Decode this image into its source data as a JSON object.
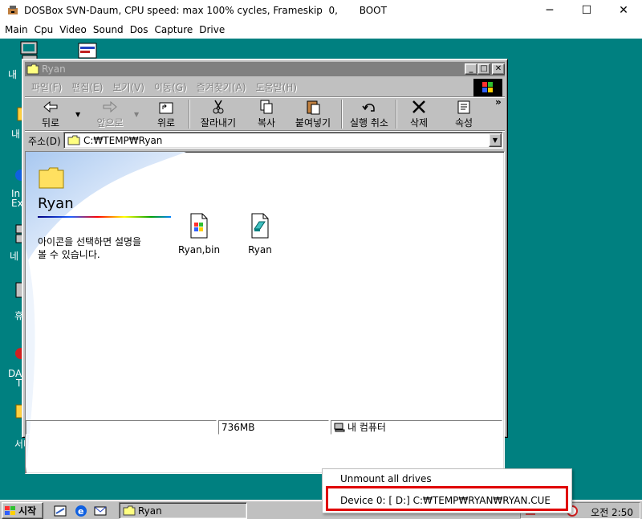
{
  "host": {
    "title": "DOSBox SVN-Daum, CPU speed: max 100% cycles, Frameskip  0,       BOOT",
    "minimize": "─",
    "maximize": "☐",
    "close": "✕",
    "menu": [
      "Main",
      "Cpu",
      "Video",
      "Sound",
      "Dos",
      "Capture",
      "Drive"
    ]
  },
  "desktop": {
    "labels": [
      "내",
      "내",
      "In",
      "Ex",
      "네",
      "휴",
      "DA",
      "T",
      "서비스"
    ]
  },
  "window": {
    "title": "Ryan",
    "menu": [
      "파일(F)",
      "편집(E)",
      "보기(V)",
      "이동(G)",
      "즐겨찾기(A)",
      "도움말(H)"
    ],
    "toolbar": {
      "back": "뒤로",
      "forward": "앞으로",
      "up": "위로",
      "cut": "잘라내기",
      "copy": "복사",
      "paste": "붙여넣기",
      "undo": "실행 취소",
      "delete": "삭제",
      "properties": "속성",
      "more": "»"
    },
    "address": {
      "label": "주소(D)",
      "value": "C:₩TEMP₩Ryan"
    },
    "pane": {
      "title": "Ryan",
      "description_line1": "아이콘을 선택하면 설명을",
      "description_line2": "볼 수 있습니다."
    },
    "files": [
      {
        "name": "Ryan,bin",
        "icon": "windows-file-icon"
      },
      {
        "name": "Ryan",
        "icon": "cd-image-file-icon"
      }
    ],
    "status": {
      "size": "736MB",
      "location": "내 컴퓨터"
    }
  },
  "taskbar": {
    "start": "시작",
    "task": "Ryan",
    "clock": "오전 2:50"
  },
  "popup": {
    "items": [
      "Unmount all drives",
      "Device 0: [ D:] C:₩TEMP₩RYAN₩RYAN.CUE"
    ]
  },
  "colors": {
    "desktop": "#008080",
    "inactive_title": "#808080",
    "highlight_box": "#e00000"
  }
}
